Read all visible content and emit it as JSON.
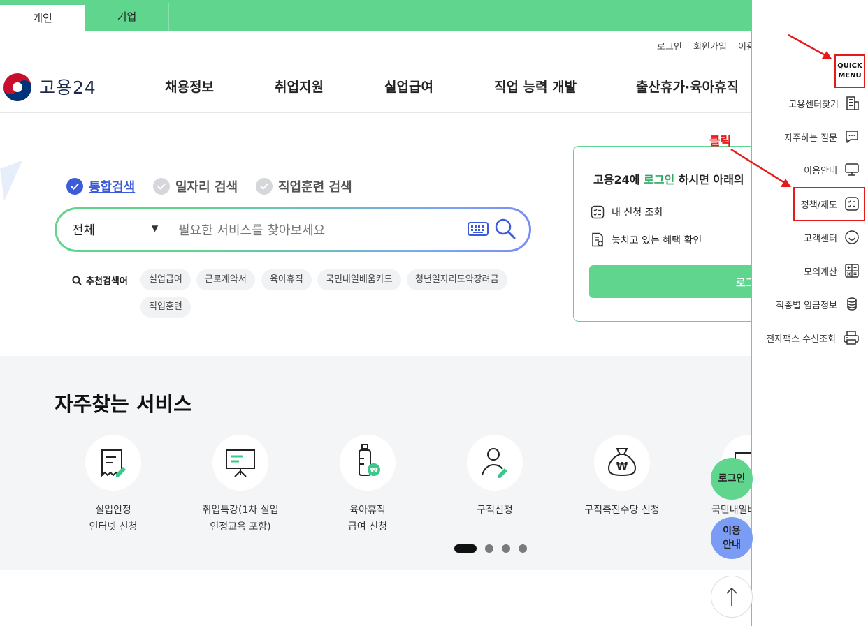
{
  "tabs": {
    "personal": "개인",
    "business": "기업"
  },
  "util_links": {
    "login": "로그인",
    "signup": "회원가입",
    "guide": "이용"
  },
  "logo": {
    "text": "고용24"
  },
  "gnb": [
    "채용정보",
    "취업지원",
    "실업급여",
    "직업 능력 개발",
    "출산휴가·육아휴직"
  ],
  "search": {
    "types": [
      "통합검색",
      "일자리 검색",
      "직업훈련 검색"
    ],
    "selected_type": "통합검색",
    "category": "전체",
    "placeholder": "필요한 서비스를 찾아보세요",
    "recommended_label": "추천검색어",
    "keywords": [
      "실업급여",
      "근로계약서",
      "육아휴직",
      "국민내일배움카드",
      "청년일자리도약장려금",
      "직업훈련"
    ]
  },
  "login_card": {
    "title_prefix": "고용24에 ",
    "title_highlight": "로그인",
    "title_suffix": " 하시면 아래의",
    "items": [
      "내 신청 조회",
      "놓치고 있는 혜택 확인"
    ],
    "button": "로그"
  },
  "frequent": {
    "title": "자주찾는 서비스",
    "services": [
      {
        "line1": "실업인정",
        "line2": "인터넷 신청",
        "icon": "document-pen-icon"
      },
      {
        "line1": "취업특강(1차 실업",
        "line2": "인정교육 포함)",
        "icon": "presentation-board-icon"
      },
      {
        "line1": "육아휴직",
        "line2": "급여 신청",
        "icon": "baby-bottle-won-icon"
      },
      {
        "line1": "구직신청",
        "line2": "",
        "icon": "person-pen-icon"
      },
      {
        "line1": "구직촉진수당 신청",
        "line2": "",
        "icon": "money-bag-won-icon"
      },
      {
        "line1": "국민내일배",
        "line2": "",
        "icon": "card-icon"
      }
    ],
    "pages": 4,
    "current_page": 1
  },
  "floating": {
    "login": "로그인",
    "guide_line1": "이용",
    "guide_line2": "안내"
  },
  "quick_menu": {
    "header_line1": "QUICK",
    "header_line2": "MENU",
    "items": [
      {
        "label": "고용센터찾기",
        "icon": "building-icon"
      },
      {
        "label": "자주하는 질문",
        "icon": "chat-bubble-icon"
      },
      {
        "label": "이용안내",
        "icon": "monitor-icon"
      },
      {
        "label": "정책/제도",
        "icon": "checklist-icon"
      },
      {
        "label": "고객센터",
        "icon": "smile-icon"
      },
      {
        "label": "모의계산",
        "icon": "calculator-icon"
      },
      {
        "label": "직종별 임금정보",
        "icon": "coins-icon"
      },
      {
        "label": "전자팩스 수신조회",
        "icon": "fax-icon"
      }
    ]
  },
  "annotation": {
    "click_label": "클릭",
    "color": "#e51b1b"
  },
  "colors": {
    "brand_green": "#5fd58e",
    "accent_blue": "#3b5bdb",
    "annotation_red": "#e51b1b"
  }
}
